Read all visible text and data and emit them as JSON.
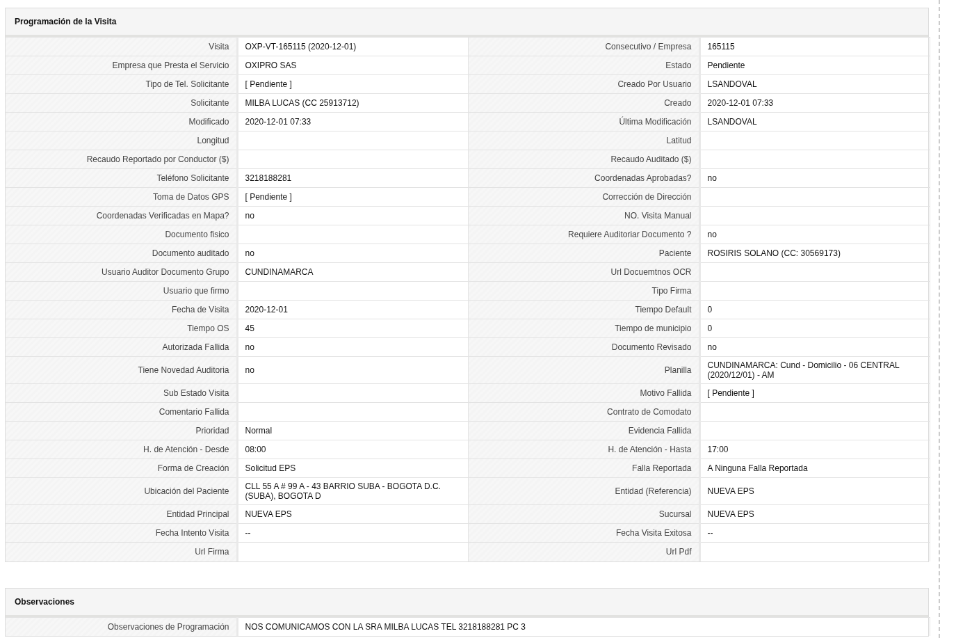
{
  "sections": [
    {
      "title": "Programación de la Visita",
      "rows": [
        {
          "cells": [
            {
              "label": "Visita",
              "value": "OXP-VT-165115 (2020-12-01)"
            },
            {
              "label": "Consecutivo / Empresa",
              "value": "165115"
            }
          ]
        },
        {
          "cells": [
            {
              "label": "Empresa que Presta el Servicio",
              "value": "OXIPRO SAS"
            },
            {
              "label": "Estado",
              "value": "Pendiente"
            }
          ]
        },
        {
          "cells": [
            {
              "label": "Tipo de Tel. Solicitante",
              "value": "[ Pendiente ]"
            },
            {
              "label": "Creado Por Usuario",
              "value": "LSANDOVAL"
            }
          ]
        },
        {
          "cells": [
            {
              "label": "Solicitante",
              "value": "MILBA LUCAS (CC 25913712)"
            },
            {
              "label": "Creado",
              "value": "2020-12-01 07:33"
            }
          ]
        },
        {
          "cells": [
            {
              "label": "Modificado",
              "value": "2020-12-01 07:33"
            },
            {
              "label": "Última Modificación",
              "value": "LSANDOVAL"
            }
          ]
        },
        {
          "cells": [
            {
              "label": "Longitud"
            },
            {
              "label": "Latitud"
            }
          ]
        },
        {
          "cells": [
            {
              "label": "Recaudo Reportado por Conductor ($)"
            },
            {
              "label": "Recaudo Auditado ($)"
            }
          ]
        },
        {
          "cells": [
            {
              "label": "Teléfono Solicitante",
              "value": "3218188281"
            },
            {
              "label": "Coordenadas Aprobadas?",
              "value": "no"
            }
          ]
        },
        {
          "cells": [
            {
              "label": "Toma de Datos GPS",
              "value": "[ Pendiente ]"
            },
            {
              "label": "Corrección de Dirección"
            }
          ]
        },
        {
          "cells": [
            {
              "label": "Coordenadas Verificadas en Mapa?",
              "value": "no"
            },
            {
              "label": "NO. Visita Manual"
            }
          ]
        },
        {
          "cells": [
            {
              "label": "Documento fisico"
            },
            {
              "label": "Requiere Auditoriar Documento ?",
              "value": "no"
            }
          ]
        },
        {
          "cells": [
            {
              "label": "Documento auditado",
              "value": "no"
            },
            {
              "label": "Paciente",
              "value": "ROSIRIS SOLANO (CC: 30569173)"
            }
          ]
        },
        {
          "cells": [
            {
              "label": "Usuario Auditor Documento Grupo",
              "value": "CUNDINAMARCA"
            },
            {
              "label": "Url Docuemtnos OCR"
            }
          ]
        },
        {
          "cells": [
            {
              "label": "Usuario que firmo"
            },
            {
              "label": "Tipo Firma"
            }
          ]
        },
        {
          "cells": [
            {
              "label": "Fecha de Visita",
              "value": "2020-12-01"
            },
            {
              "label": "Tiempo Default",
              "value": "0"
            }
          ]
        },
        {
          "cells": [
            {
              "label": "Tiempo OS",
              "value": "45"
            },
            {
              "label": "Tiempo de municipio",
              "value": "0"
            }
          ]
        },
        {
          "cells": [
            {
              "label": "Autorizada Fallida",
              "value": "no"
            },
            {
              "label": "Documento Revisado",
              "value": "no"
            }
          ]
        },
        {
          "cells": [
            {
              "label": "Tiene Novedad Auditoria",
              "value": "no"
            },
            {
              "label": "Planilla",
              "value": "CUNDINAMARCA: Cund - Domicilio - 06 CENTRAL (2020/12/01) - AM"
            }
          ]
        },
        {
          "cells": [
            {
              "label": "Sub Estado Visita"
            },
            {
              "label": "Motivo Fallida",
              "value": "[ Pendiente ]"
            }
          ]
        },
        {
          "cells": [
            {
              "label": "Comentario Fallida"
            },
            {
              "label": "Contrato de Comodato"
            }
          ]
        },
        {
          "cells": [
            {
              "label": "Prioridad",
              "value": "Normal"
            },
            {
              "label": "Evidencia Fallida"
            }
          ]
        },
        {
          "cells": [
            {
              "label": "H. de Atención - Desde",
              "value": "08:00"
            },
            {
              "label": "H. de Atención - Hasta",
              "value": "17:00"
            }
          ]
        },
        {
          "cells": [
            {
              "label": "Forma de Creación",
              "value": "Solicitud EPS"
            },
            {
              "label": "Falla Reportada",
              "value": "A Ninguna Falla Reportada"
            }
          ]
        },
        {
          "cells": [
            {
              "label": "Ubicación del Paciente",
              "value": "CLL 55 A # 99 A - 43 BARRIO SUBA - BOGOTA D.C. (SUBA), BOGOTA D"
            },
            {
              "label": "Entidad (Referencia)",
              "value": "NUEVA EPS"
            }
          ]
        },
        {
          "cells": [
            {
              "label": "Entidad Principal",
              "value": "NUEVA EPS"
            },
            {
              "label": "Sucursal",
              "value": "NUEVA EPS"
            }
          ]
        },
        {
          "cells": [
            {
              "label": "Fecha Intento Visita",
              "value": "--"
            },
            {
              "label": "Fecha Visita Exitosa",
              "value": "--"
            }
          ]
        },
        {
          "cells": [
            {
              "label": "Url Firma"
            },
            {
              "label": "Url Pdf"
            }
          ]
        }
      ]
    },
    {
      "title": "Observaciones",
      "rows": [
        {
          "cells": [
            {
              "label": "Observaciones de Programación",
              "value": "NOS COMUNICAMOS CON LA SRA MILBA LUCAS TEL 3218188281 PC 3"
            }
          ]
        }
      ]
    }
  ]
}
